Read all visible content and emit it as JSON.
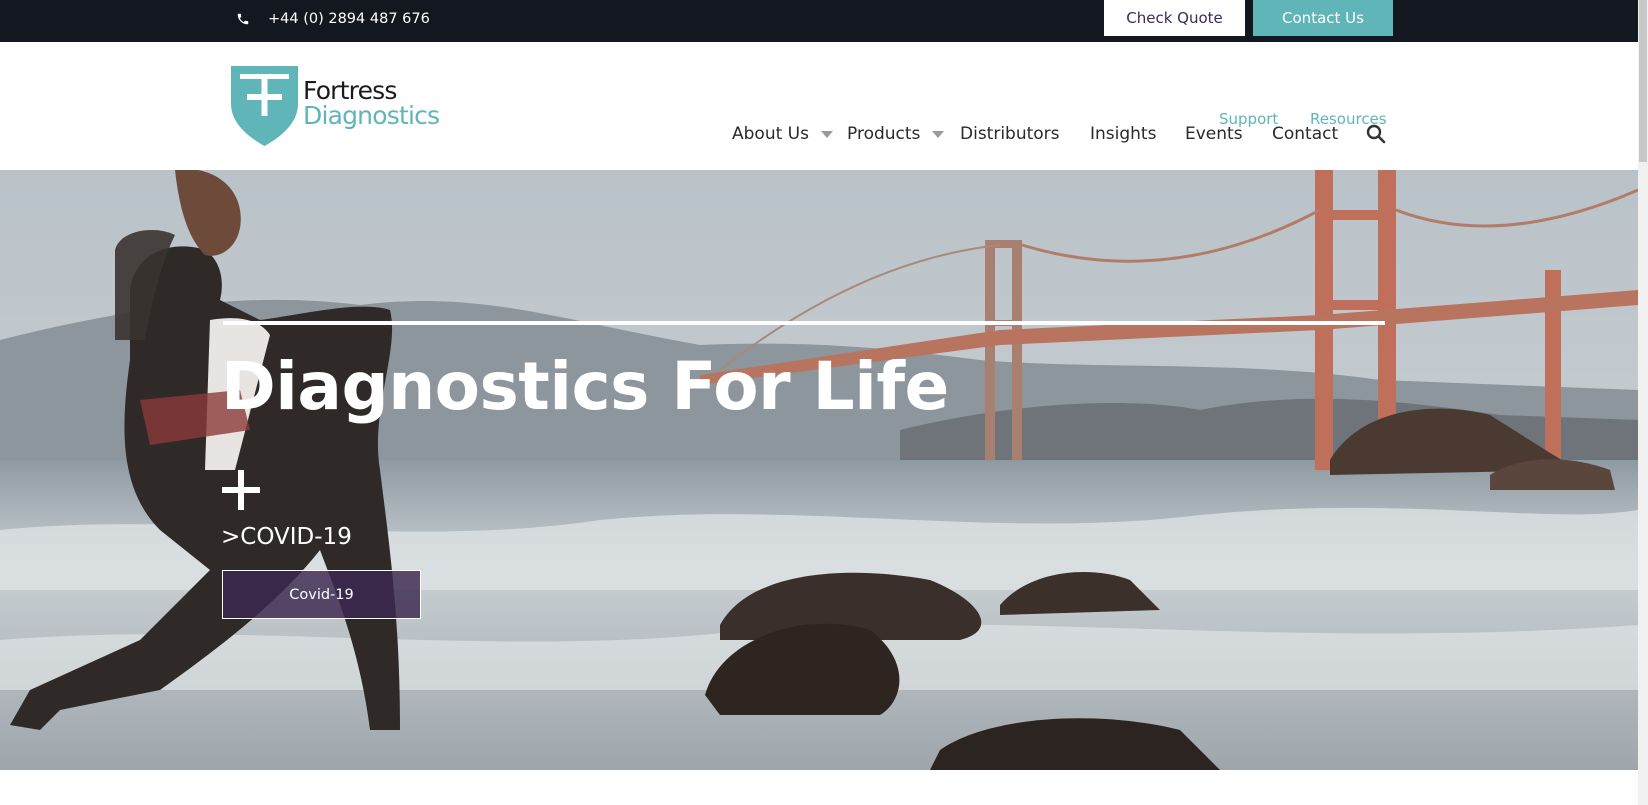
{
  "topbar": {
    "phone": "+44 (0) 2894 487 676",
    "check_quote": "Check Quote",
    "contact_us": "Contact Us"
  },
  "header": {
    "logo_line1": "Fortress",
    "logo_line2": "Diagnostics",
    "utility_links": [
      "Support",
      "Resources"
    ],
    "nav": [
      {
        "label": "About Us",
        "dropdown": true
      },
      {
        "label": "Products",
        "dropdown": true
      },
      {
        "label": "Distributors",
        "dropdown": false
      },
      {
        "label": "Insights",
        "dropdown": false
      },
      {
        "label": "Events",
        "dropdown": false
      },
      {
        "label": "Contact",
        "dropdown": false
      }
    ],
    "search_icon": "search-icon"
  },
  "hero": {
    "title": "Diagnostics For Life",
    "subheading": ">COVID-19",
    "button": "Covid-19"
  },
  "colors": {
    "topbar_bg": "#13171f",
    "accent_teal": "#5fb5b7",
    "button_purple": "#3c2850"
  }
}
